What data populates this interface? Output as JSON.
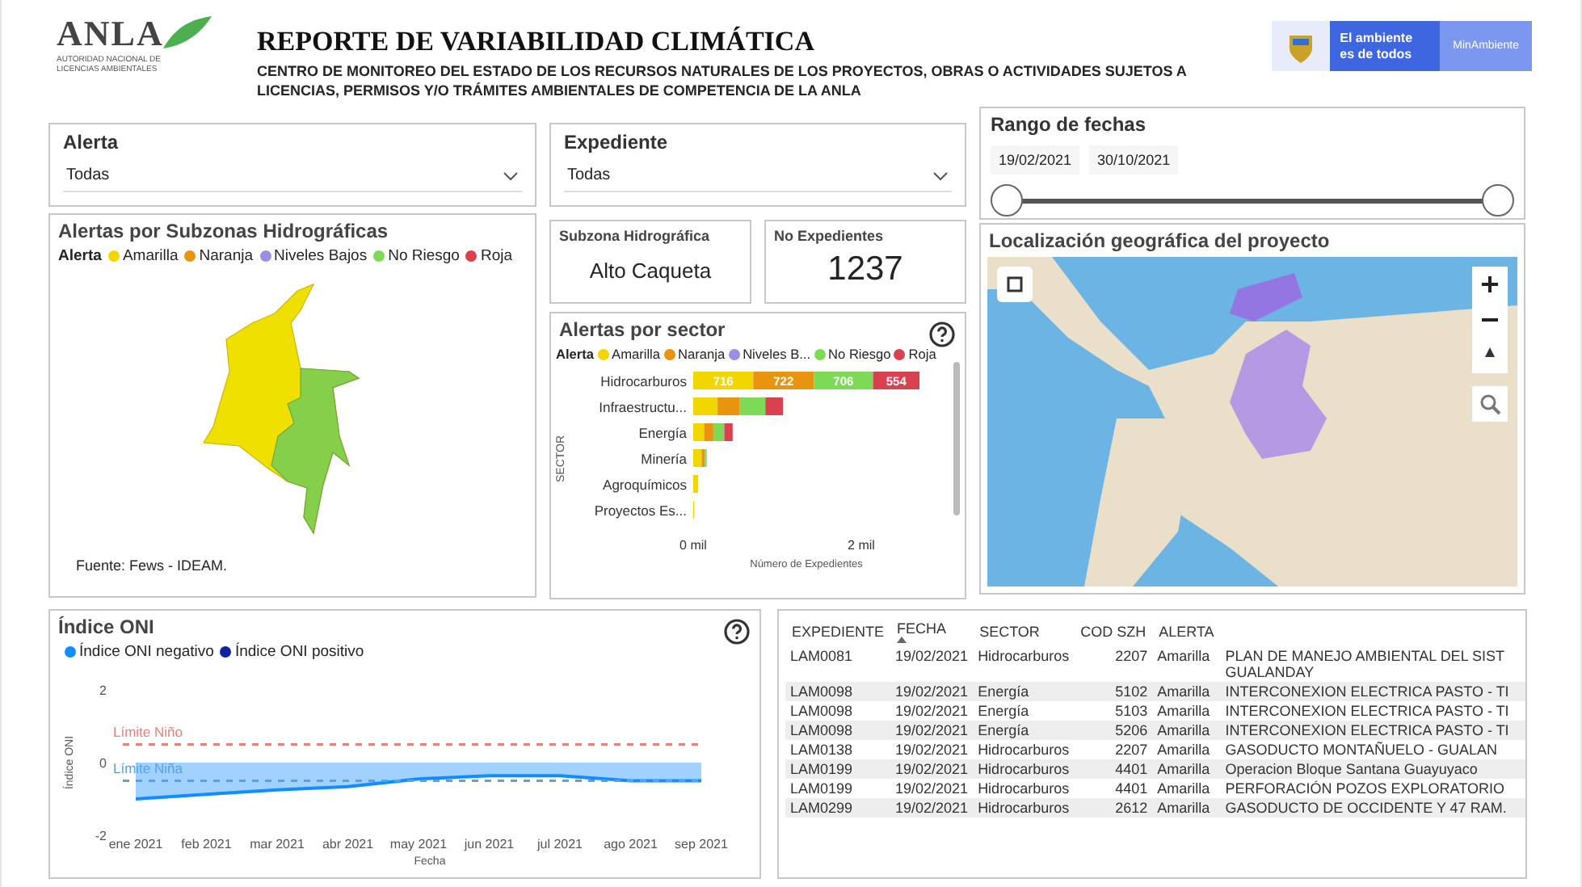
{
  "header": {
    "logo_text": "ANLA",
    "logo_caption": "AUTORIDAD NACIONAL DE LICENCIAS AMBIENTALES",
    "title": "REPORTE DE VARIABILIDAD CLIMÁTICA",
    "subtitle": "CENTRO DE MONITOREO DEL ESTADO DE LOS RECURSOS NATURALES DE LOS PROYECTOS, OBRAS O ACTIVIDADES SUJETOS A LICENCIAS, PERMISOS Y/O TRÁMITES AMBIENTALES DE COMPETENCIA DE LA ANLA",
    "slogan": "El ambiente es de todos",
    "ministry": "MinAmbiente"
  },
  "filters": [
    {
      "label": "Alerta",
      "value": "Todas"
    },
    {
      "label": "Expediente",
      "value": "Todas"
    }
  ],
  "date_range": {
    "title": "Rango de fechas",
    "start": "19/02/2021",
    "end": "30/10/2021",
    "thumbs": [
      {
        "level": 0
      },
      {
        "level": 1
      }
    ]
  },
  "subzone_map": {
    "title": "Alertas por Subzonas Hidrográficas",
    "legend_title": "Alerta",
    "legend": [
      {
        "label": "Amarilla",
        "color": "#f2d600"
      },
      {
        "label": "Naranja",
        "color": "#e8940f"
      },
      {
        "label": "Niveles Bajos",
        "color": "#9b8fe0"
      },
      {
        "label": "No Riesgo",
        "color": "#7ed957"
      },
      {
        "label": "Roja",
        "color": "#d9414f"
      }
    ],
    "source": "Fuente: Fews - IDEAM."
  },
  "cards": [
    {
      "label": "Subzona Hidrográfica",
      "value": "Alto Caqueta",
      "kind": "text"
    },
    {
      "label": "No Expedientes",
      "value": "1237",
      "kind": "number"
    }
  ],
  "sector_chart": {
    "title": "Alertas por sector",
    "legend_title": "Alerta",
    "chart_data": {
      "type": "bar",
      "orientation": "horizontal",
      "stacked": true,
      "xlabel": "Número de Expedientes",
      "ylabel": "SECTOR",
      "categories": [
        "Hidrocarburos",
        "Infraestructu...",
        "Energía",
        "Minería",
        "Agroquímicos",
        "Proyectos Es..."
      ],
      "annotations": [
        "0 mil",
        "2 mil"
      ],
      "series": [
        {
          "name": "Amarilla",
          "color": "#f2d600",
          "values": [
            716,
            290,
            130,
            100,
            60,
            10
          ],
          "value_labels": [
            "716",
            null,
            null,
            null,
            null,
            null
          ]
        },
        {
          "name": "Naranja",
          "color": "#e8940f",
          "values": [
            722,
            260,
            110,
            40,
            0,
            0
          ],
          "value_labels": [
            "722",
            null,
            null,
            null,
            null,
            null
          ]
        },
        {
          "name": "Niveles B...",
          "color": "#9b8fe0",
          "values": [
            0,
            0,
            0,
            0,
            0,
            0
          ]
        },
        {
          "name": "No Riesgo",
          "color": "#7ed957",
          "values": [
            706,
            310,
            130,
            20,
            0,
            0
          ],
          "value_labels": [
            "706",
            null,
            null,
            null,
            null,
            null
          ]
        },
        {
          "name": "Roja",
          "color": "#d9414f",
          "values": [
            554,
            210,
            100,
            0,
            0,
            0
          ],
          "value_labels": [
            "554",
            null,
            null,
            null,
            null,
            null
          ]
        }
      ]
    }
  },
  "location_map": {
    "title": "Localización geográfica del proyecto"
  },
  "oni_chart": {
    "title": "Índice ONI",
    "chart_data": {
      "type": "area",
      "xlabel": "Fecha",
      "ylabel": "Índice ONI",
      "categories": [
        "ene 2021",
        "feb 2021",
        "mar 2021",
        "abr 2021",
        "may 2021",
        "jun 2021",
        "jul 2021",
        "ago 2021",
        "sep 2021"
      ],
      "ylim": [
        -2,
        2
      ],
      "yticks": [
        -2,
        0,
        2
      ],
      "series": [
        {
          "name": "Índice ONI negativo",
          "color": "#118dff",
          "values": [
            -1.0,
            -0.87,
            -0.75,
            -0.66,
            -0.45,
            -0.36,
            -0.36,
            -0.5,
            -0.5
          ]
        },
        {
          "name": "Índice ONI positivo",
          "color": "#12239e",
          "values": [
            null,
            null,
            null,
            null,
            null,
            null,
            null,
            null,
            null
          ]
        }
      ],
      "ref_lines": [
        {
          "axis": "y",
          "value": 0.5,
          "label": "Límite Niño"
        },
        {
          "axis": "y",
          "value": -0.5,
          "label": "Límite Niña"
        }
      ]
    }
  },
  "table": {
    "columns": [
      {
        "label": "EXPEDIENTE",
        "sorted": false
      },
      {
        "label": "FECHA",
        "sorted": true
      },
      {
        "label": "SECTOR",
        "sorted": false
      },
      {
        "label": "COD SZH",
        "sorted": false
      },
      {
        "label": "ALERTA",
        "sorted": false
      },
      {
        "sorted": false
      }
    ],
    "rows": [
      [
        "LAM0081",
        "19/02/2021",
        "Hidrocarburos",
        "2207",
        "Amarilla",
        "PLAN DE MANEJO AMBIENTAL DEL SIST GUALANDAY"
      ],
      [
        "LAM0098",
        "19/02/2021",
        "Energía",
        "5102",
        "Amarilla",
        "INTERCONEXION ELECTRICA PASTO - TI"
      ],
      [
        "LAM0098",
        "19/02/2021",
        "Energía",
        "5103",
        "Amarilla",
        "INTERCONEXION ELECTRICA PASTO - TI"
      ],
      [
        "LAM0098",
        "19/02/2021",
        "Energía",
        "5206",
        "Amarilla",
        "INTERCONEXION ELECTRICA PASTO - TI"
      ],
      [
        "LAM0138",
        "19/02/2021",
        "Hidrocarburos",
        "2207",
        "Amarilla",
        "GASODUCTO MONTAÑUELO - GUALAN"
      ],
      [
        "LAM0199",
        "19/02/2021",
        "Hidrocarburos",
        "4401",
        "Amarilla",
        "Operacion Bloque Santana Guayuyaco"
      ],
      [
        "LAM0199",
        "19/02/2021",
        "Hidrocarburos",
        "4401",
        "Amarilla",
        "PERFORACIÓN POZOS EXPLORATORIO"
      ],
      [
        "LAM0299",
        "19/02/2021",
        "Hidrocarburos",
        "2612",
        "Amarilla",
        "GASODUCTO DE OCCIDENTE Y 47 RAM."
      ]
    ]
  }
}
